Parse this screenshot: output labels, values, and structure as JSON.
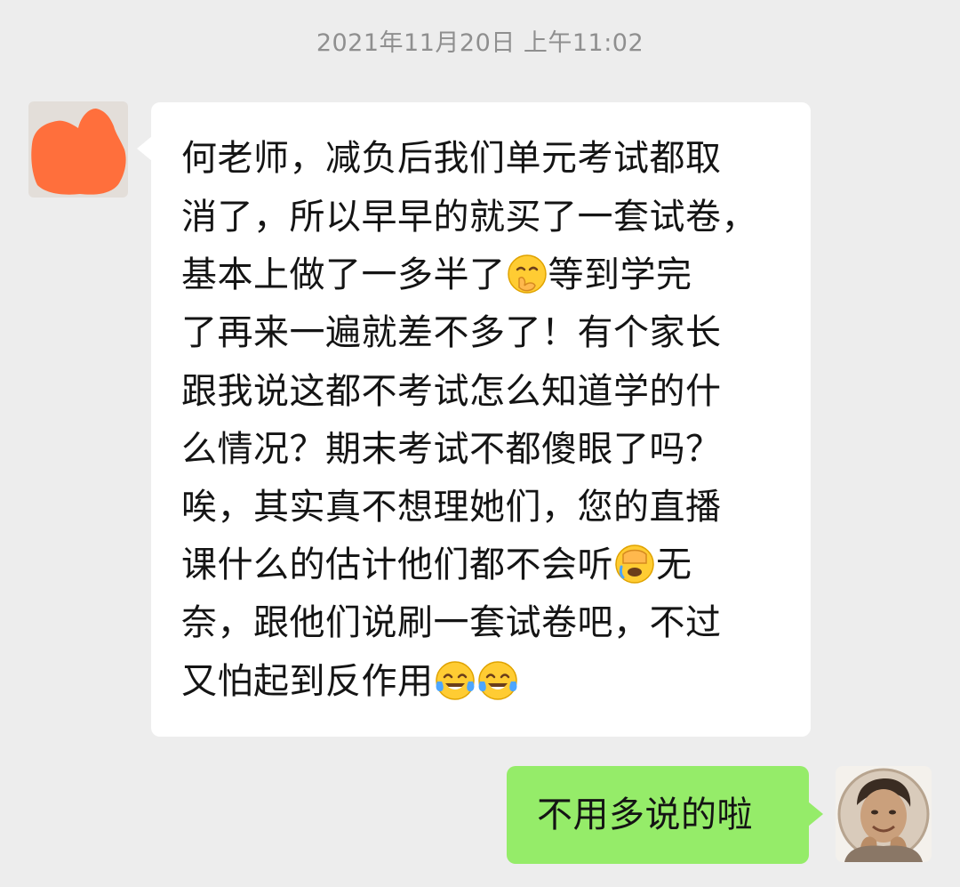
{
  "chat": {
    "timestamp": "2021年11月20日 上午11:02",
    "incoming": {
      "avatar": "redacted-avatar",
      "lines": [
        {
          "parts": [
            {
              "t": "何老师，减负后我们单元考试都取"
            }
          ]
        },
        {
          "parts": [
            {
              "t": "消了，所以早早的就买了一套试卷，"
            }
          ]
        },
        {
          "parts": [
            {
              "t": "基本上做了一多半了"
            },
            {
              "emoji": "hand-over-mouth-emoji"
            },
            {
              "t": "等到学完"
            }
          ]
        },
        {
          "parts": [
            {
              "t": "了再来一遍就差不多了！有个家长"
            }
          ]
        },
        {
          "parts": [
            {
              "t": "跟我说这都不考试怎么知道学的什"
            }
          ]
        },
        {
          "parts": [
            {
              "t": "么情况？期末考试不都傻眼了吗？"
            }
          ]
        },
        {
          "parts": [
            {
              "t": "唉，其实真不想理她们，您的直播"
            }
          ]
        },
        {
          "parts": [
            {
              "t": "课什么的估计他们都不会听"
            },
            {
              "emoji": "facepalm-emoji"
            },
            {
              "t": "无"
            }
          ]
        },
        {
          "parts": [
            {
              "t": "奈，跟他们说刷一套试卷吧，不过"
            }
          ]
        },
        {
          "parts": [
            {
              "t": "又怕起到反作用"
            },
            {
              "emoji": "tears-of-joy-emoji"
            },
            {
              "emoji": "tears-of-joy-emoji"
            }
          ]
        }
      ]
    },
    "outgoing": {
      "text": "不用多说的啦",
      "avatar": "user-avatar-photo"
    },
    "colors": {
      "background": "#ededed",
      "incoming_bubble": "#ffffff",
      "outgoing_bubble": "#95ec69",
      "timestamp": "#8f8f8f",
      "redaction": "#ff6f3c"
    }
  }
}
